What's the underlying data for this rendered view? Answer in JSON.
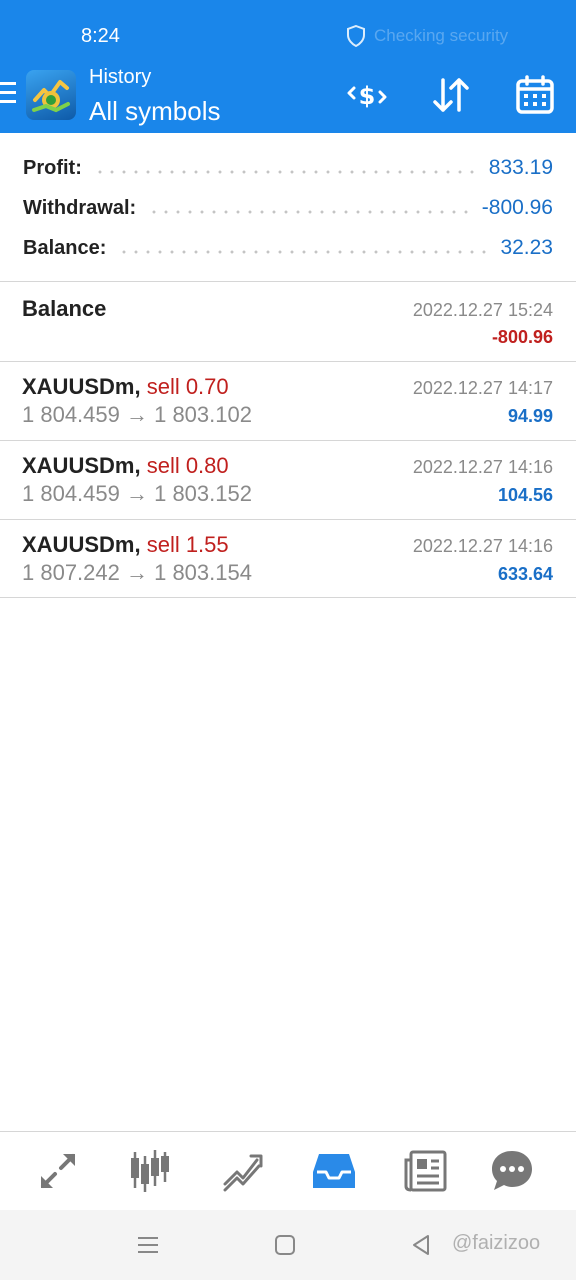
{
  "status_bar": {
    "time": "8:24",
    "security_text": "Checking security"
  },
  "app_bar": {
    "subtitle": "History",
    "title": "All symbols"
  },
  "summary": {
    "profit_label": "Profit:",
    "profit_value": "833.19",
    "withdrawal_label": "Withdrawal:",
    "withdrawal_value": "-800.96",
    "balance_label": "Balance:",
    "balance_value": "32.23"
  },
  "balance_entry": {
    "title": "Balance",
    "time": "2022.12.27 15:24",
    "amount": "-800.96"
  },
  "deals": [
    {
      "symbol": "XAUUSDm,",
      "side": "sell 0.70",
      "prices": "1 804.459 → 1 803.102",
      "time": "2022.12.27 14:17",
      "profit": "94.99"
    },
    {
      "symbol": "XAUUSDm,",
      "side": "sell 0.80",
      "prices": "1 804.459 → 1 803.152",
      "time": "2022.12.27 14:16",
      "profit": "104.56"
    },
    {
      "symbol": "XAUUSDm,",
      "side": "sell 1.55",
      "prices": "1 807.242 → 1 803.154",
      "time": "2022.12.27 14:16",
      "profit": "633.64"
    }
  ],
  "bottom_nav": [
    "quotes-icon",
    "chart-icon",
    "trade-icon",
    "history-icon",
    "news-icon",
    "chat-icon"
  ],
  "watermark": "@faizizoo",
  "colors": {
    "accent": "#1a86ea",
    "positive": "#1a6fc7",
    "negative": "#c0201e",
    "active_nav": "#2a8ae8",
    "inactive_nav": "#777777"
  }
}
